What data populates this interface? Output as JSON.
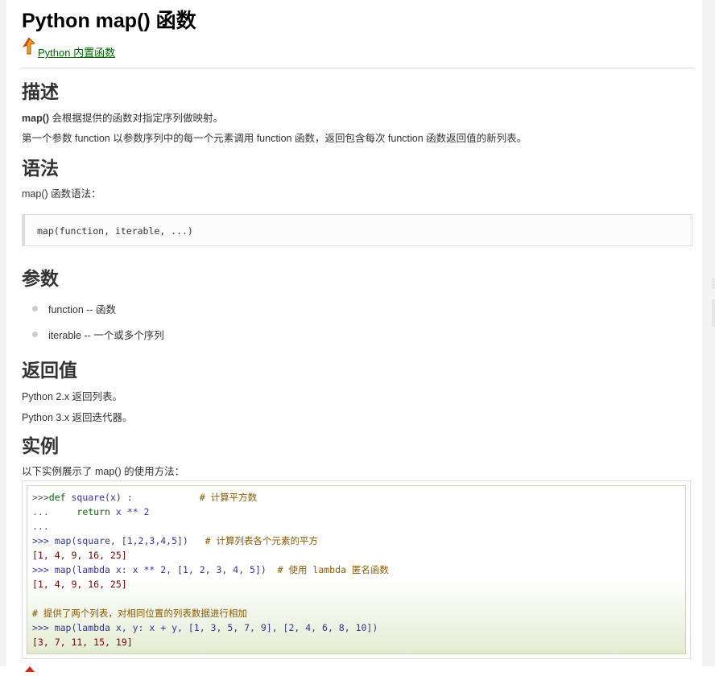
{
  "page": {
    "title": "Python map() 函数",
    "back_link": "Python 内置函数"
  },
  "desc": {
    "heading": "描述",
    "line1_bold": "map()",
    "line1_rest": " 会根据提供的函数对指定序列做映射。",
    "line2": "第一个参数 function 以参数序列中的每一个元素调用 function 函数，返回包含每次 function 函数返回值的新列表。"
  },
  "syntax": {
    "heading": "语法",
    "intro": "map() 函数语法：",
    "code": "map(function, iterable, ...)"
  },
  "params": {
    "heading": "参数",
    "items": [
      "function -- 函数",
      "iterable -- 一个或多个序列"
    ]
  },
  "returns": {
    "heading": "返回值",
    "line1": "Python 2.x 返回列表。",
    "line2": "Python 3.x 返回迭代器。"
  },
  "example": {
    "heading": "实例",
    "intro": "以下实例展示了 map() 的使用方法：",
    "lines": {
      "l1_prompt": ">>>",
      "l1_def": "def",
      "l1_fn": " square",
      "l1_args": "(x) :            ",
      "l1_comment": "# 计算平方数",
      "l2_prompt": "...     ",
      "l2_return": "return",
      "l2_expr": " x ** 2",
      "l3": "...",
      "l4_code": ">>> map(square, [1,2,3,4,5])   ",
      "l4_comment": "# 计算列表各个元素的平方",
      "l5": "[1, 4, 9, 16, 25]",
      "l6_code": ">>> map(lambda x: x ** 2, [1, 2, 3, 4, 5])  ",
      "l6_comment": "# 使用 lambda 匿名函数",
      "l7": "[1, 4, 9, 16, 25]",
      "l9_comment": "# 提供了两个列表，对相同位置的列表数据进行相加",
      "l10": ">>> map(lambda x, y: x + y, [1, 3, 5, 7, 9], [2, 4, 6, 8, 10])",
      "l11": "[3, 7, 11, 15, 19]"
    }
  },
  "icons": {
    "back": "up-arrow-icon",
    "bottom": "up-arrow-icon"
  },
  "colors": {
    "link": "#006600",
    "code_keyword": "#006600",
    "code_comment": "#8a5a00",
    "example_border": "#c8d5b0"
  }
}
